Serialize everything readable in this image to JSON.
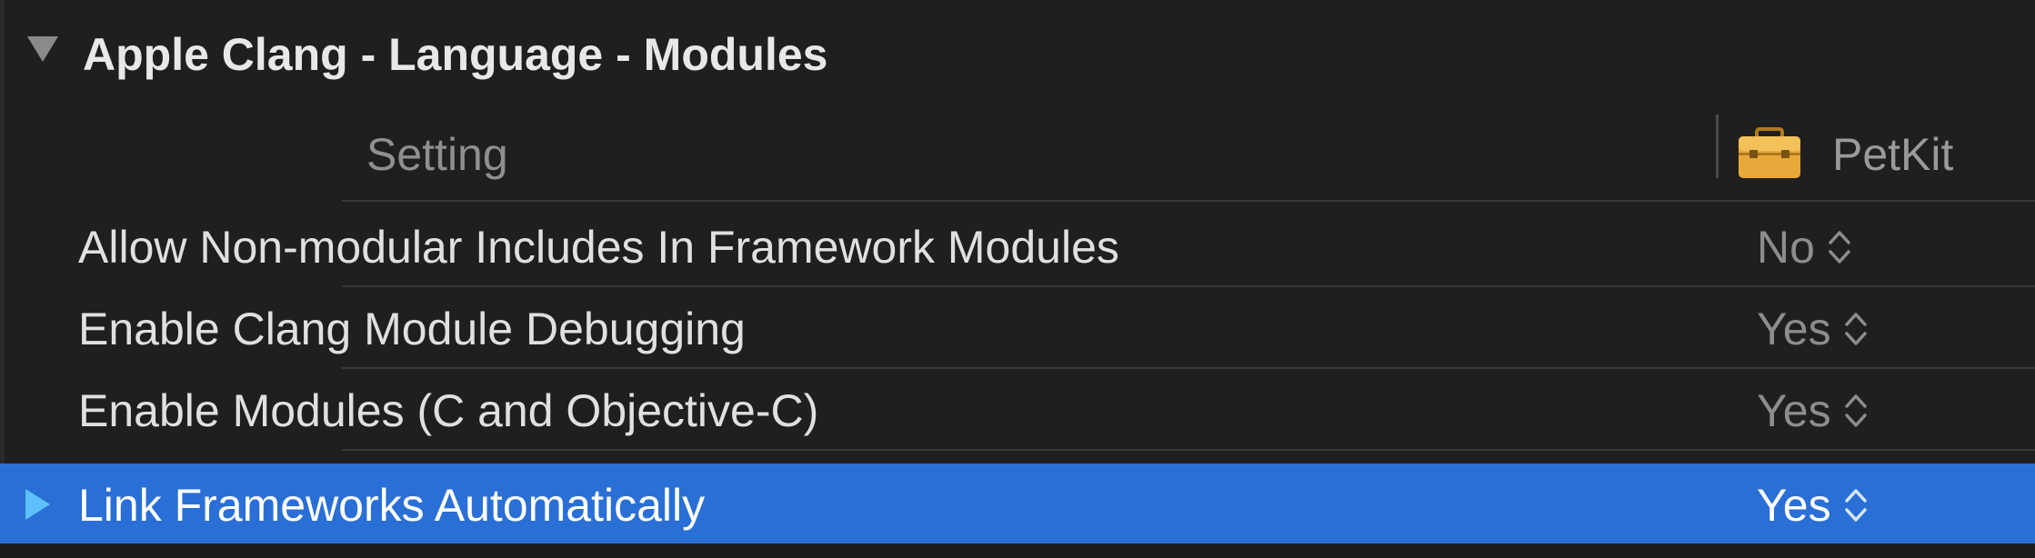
{
  "section": {
    "title": "Apple Clang - Language - Modules"
  },
  "columns": {
    "setting": "Setting",
    "target": "PetKit"
  },
  "rows": [
    {
      "label": "Allow Non-modular Includes In Framework Modules",
      "value": "No",
      "selected": false
    },
    {
      "label": "Enable Clang Module Debugging",
      "value": "Yes",
      "selected": false
    },
    {
      "label": "Enable Modules (C and Objective-C)",
      "value": "Yes",
      "selected": false
    },
    {
      "label": "Link Frameworks Automatically",
      "value": "Yes",
      "selected": true
    }
  ],
  "colors": {
    "background": "#1f1f1f",
    "selection": "#2a6fd6",
    "disclosure_selected": "#5ec0ff",
    "toolbox": "#e8a83a"
  },
  "icons": {
    "section_disclosure": "triangle-down-icon",
    "row_disclosure": "triangle-right-icon",
    "target": "toolbox-icon",
    "stepper": "up-down-chevron-icon"
  }
}
